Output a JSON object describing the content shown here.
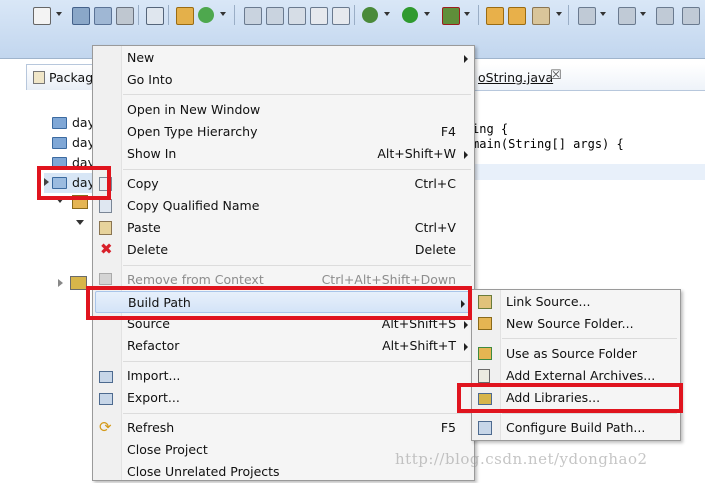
{
  "package_explorer": {
    "tab_label": "Packag",
    "tree_items": [
      "day",
      "day",
      "day",
      "day"
    ]
  },
  "editor": {
    "tab_label": "oString.java",
    "tab_close": "☒",
    "code_lines": [
      "ing {",
      " main(String[] args) {"
    ]
  },
  "context_menu": {
    "items": {
      "new": {
        "label": "New"
      },
      "go_into": {
        "label": "Go Into"
      },
      "open_new_window": {
        "label": "Open in New Window"
      },
      "open_type_hierarchy": {
        "label": "Open Type Hierarchy",
        "shortcut": "F4"
      },
      "show_in": {
        "label": "Show In",
        "shortcut": "Alt+Shift+W"
      },
      "copy": {
        "label": "Copy",
        "shortcut": "Ctrl+C"
      },
      "copy_qualified": {
        "label": "Copy Qualified Name"
      },
      "paste": {
        "label": "Paste",
        "shortcut": "Ctrl+V"
      },
      "delete": {
        "label": "Delete",
        "shortcut": "Delete"
      },
      "remove_context": {
        "label": "Remove from Context",
        "shortcut": "Ctrl+Alt+Shift+Down"
      },
      "build_path": {
        "label": "Build Path"
      },
      "source": {
        "label": "Source",
        "shortcut": "Alt+Shift+S"
      },
      "refactor": {
        "label": "Refactor",
        "shortcut": "Alt+Shift+T"
      },
      "import": {
        "label": "Import..."
      },
      "export": {
        "label": "Export..."
      },
      "refresh": {
        "label": "Refresh",
        "shortcut": "F5"
      },
      "close_project": {
        "label": "Close Project"
      },
      "close_unrelated": {
        "label": "Close Unrelated Projects"
      }
    }
  },
  "build_path_submenu": {
    "items": {
      "link_source": {
        "label": "Link Source..."
      },
      "new_source_folder": {
        "label": "New Source Folder..."
      },
      "use_as_source": {
        "label": "Use as Source Folder"
      },
      "add_external_archives": {
        "label": "Add External Archives..."
      },
      "add_libraries": {
        "label": "Add Libraries..."
      },
      "configure_build_path": {
        "label": "Configure Build Path..."
      }
    }
  },
  "watermark": "http://blog.csdn.net/ydonghao2",
  "colors": {
    "highlight_box": "#e0141e",
    "menu_bg": "#f5f5f5",
    "toolbar_bg": "#c8daf0"
  }
}
